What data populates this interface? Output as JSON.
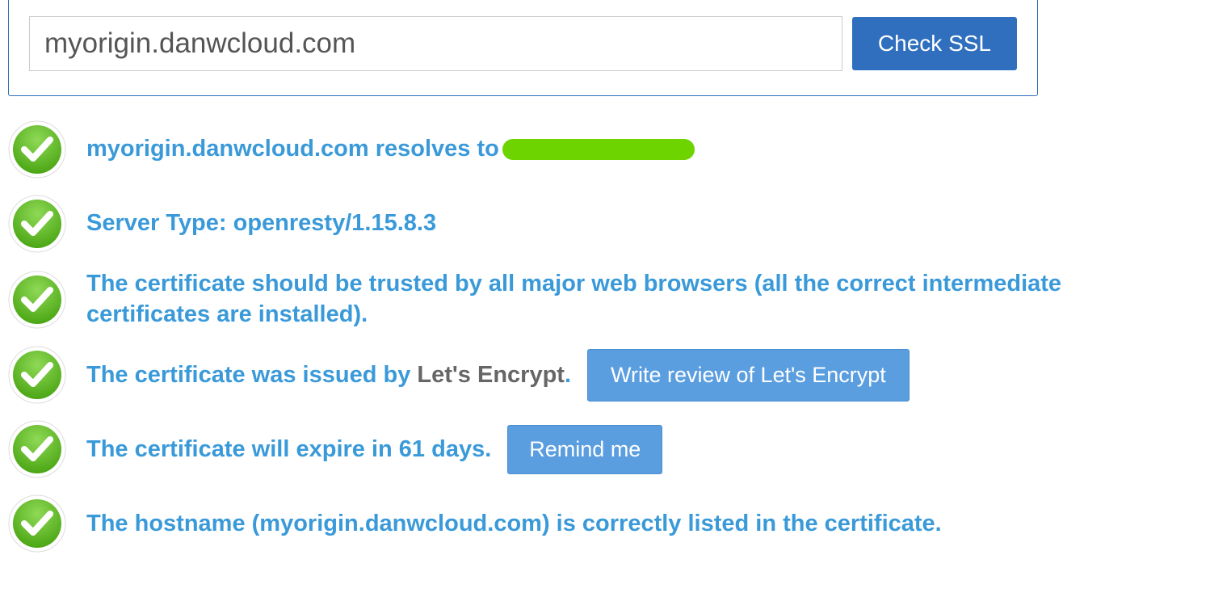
{
  "search": {
    "value": "myorigin.danwcloud.com",
    "button_label": "Check SSL"
  },
  "results": [
    {
      "text_before": "myorigin.danwcloud.com resolves to",
      "redacted": true
    },
    {
      "text": "Server Type: openresty/1.15.8.3"
    },
    {
      "text": "The certificate should be trusted by all major web browsers (all the correct intermediate certificates are installed)."
    },
    {
      "text_before": "The certificate was issued by ",
      "issuer": "Let's Encrypt",
      "text_after": ".",
      "button": "Write review of Let's Encrypt"
    },
    {
      "text": "The certificate will expire in 61 days.",
      "button": "Remind me"
    },
    {
      "text": "The hostname (myorigin.danwcloud.com) is correctly listed in the certificate."
    }
  ]
}
